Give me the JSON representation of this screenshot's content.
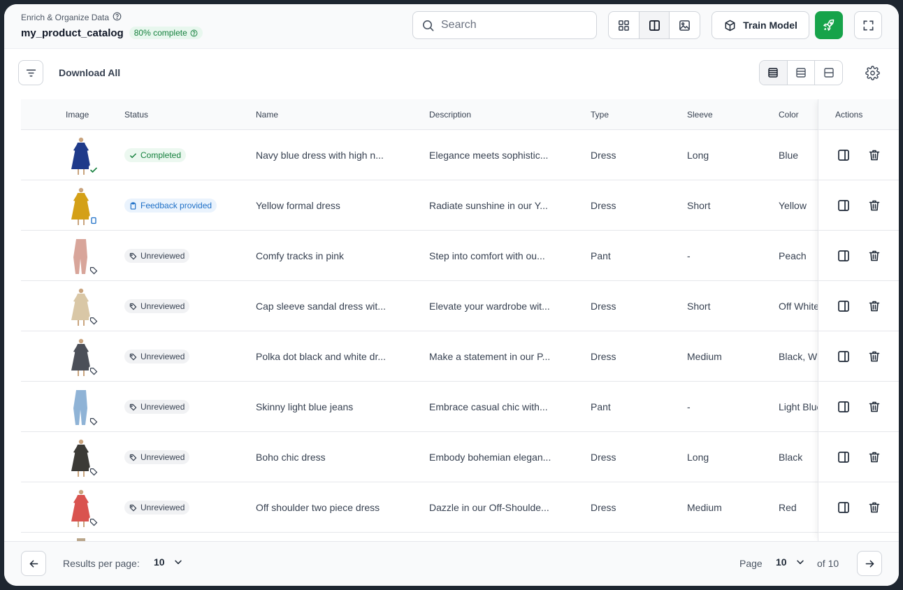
{
  "header": {
    "breadcrumb": "Enrich & Organize Data",
    "project_name": "my_product_catalog",
    "progress_label": "80% complete",
    "progress": 0.8
  },
  "search": {
    "placeholder": "Search",
    "value": ""
  },
  "toolbar": {
    "view_icons": [
      "grid-icon",
      "split-view-icon",
      "image-icon"
    ],
    "train_label": "Train Model",
    "accent_color": "#16a34a"
  },
  "subbar": {
    "download_label": "Download All"
  },
  "table": {
    "columns": [
      "Image",
      "Status",
      "Name",
      "Description",
      "Type",
      "Sleeve",
      "Color",
      "Actions"
    ],
    "rows": [
      {
        "status": "Completed",
        "status_kind": "completed",
        "name": "Navy blue dress with high n...",
        "description": "Elegance meets sophistic...",
        "type": "Dress",
        "sleeve": "Long",
        "color": "Blue",
        "swatch": "#1f3a8a"
      },
      {
        "status": "Feedback provided",
        "status_kind": "feedback",
        "name": "Yellow formal dress",
        "description": "Radiate sunshine in our Y...",
        "type": "Dress",
        "sleeve": "Short",
        "color": "Yellow",
        "swatch": "#d4a017"
      },
      {
        "status": "Unreviewed",
        "status_kind": "unreviewed",
        "name": "Comfy tracks in pink",
        "description": "Step into comfort with ou...",
        "type": "Pant",
        "sleeve": "-",
        "color": "Peach",
        "swatch": "#d8a59a"
      },
      {
        "status": "Unreviewed",
        "status_kind": "unreviewed",
        "name": "Cap sleeve sandal dress wit...",
        "description": "Elevate your wardrobe wit...",
        "type": "Dress",
        "sleeve": "Short",
        "color": "Off White",
        "swatch": "#d9c7a6"
      },
      {
        "status": "Unreviewed",
        "status_kind": "unreviewed",
        "name": "Polka dot black and white dr...",
        "description": "Make a statement in our P...",
        "type": "Dress",
        "sleeve": "Medium",
        "color": "Black, White",
        "swatch": "#4b4f58"
      },
      {
        "status": "Unreviewed",
        "status_kind": "unreviewed",
        "name": "Skinny light blue jeans",
        "description": "Embrace casual chic with...",
        "type": "Pant",
        "sleeve": "-",
        "color": "Light Blue",
        "swatch": "#8fb3d6"
      },
      {
        "status": "Unreviewed",
        "status_kind": "unreviewed",
        "name": "Boho chic dress",
        "description": "Embody bohemian elegan...",
        "type": "Dress",
        "sleeve": "Long",
        "color": "Black",
        "swatch": "#3b3a36"
      },
      {
        "status": "Unreviewed",
        "status_kind": "unreviewed",
        "name": "Off shoulder two piece dress",
        "description": "Dazzle in our Off-Shoulde...",
        "type": "Dress",
        "sleeve": "Medium",
        "color": "Red",
        "swatch": "#d9534f"
      }
    ]
  },
  "pagination": {
    "results_per_page_label": "Results per page:",
    "results_per_page": "10",
    "page_label": "Page",
    "page": "10",
    "of_label": "of 10"
  }
}
